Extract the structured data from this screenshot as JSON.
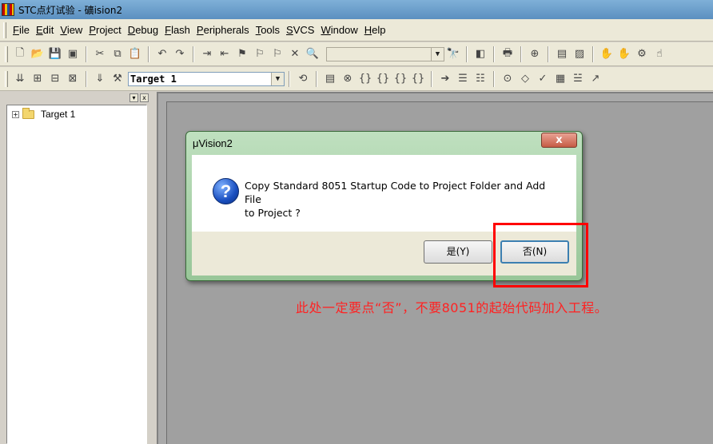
{
  "window": {
    "title": "STC点灯试验 - 礦ision2"
  },
  "menu": {
    "items": [
      {
        "ul": "F",
        "rest": "ile"
      },
      {
        "ul": "E",
        "rest": "dit"
      },
      {
        "ul": "V",
        "rest": "iew"
      },
      {
        "ul": "P",
        "rest": "roject"
      },
      {
        "ul": "D",
        "rest": "ebug"
      },
      {
        "ul": "F",
        "rest": "lash"
      },
      {
        "ul": "P",
        "rest": "eripherals"
      },
      {
        "ul": "T",
        "rest": "ools"
      },
      {
        "ul": "S",
        "rest": "VCS"
      },
      {
        "ul": "W",
        "rest": "indow"
      },
      {
        "ul": "H",
        "rest": "elp"
      }
    ]
  },
  "toolbar2": {
    "target_select": "Target 1"
  },
  "project": {
    "tree_root": "Target 1"
  },
  "dialog": {
    "title": "μVision2",
    "close_glyph": "x",
    "message_line1": "Copy Standard 8051 Startup Code to Project Folder and Add File",
    "message_line2": "to Project ?",
    "yes_label": "是(Y)",
    "no_label": "否(N)"
  },
  "annotation": {
    "note": "此处一定要点“否”，不要8051的起始代码加入工程。"
  },
  "colors": {
    "annotation_red": "#ff0000",
    "dialog_frame": "#98c698"
  }
}
